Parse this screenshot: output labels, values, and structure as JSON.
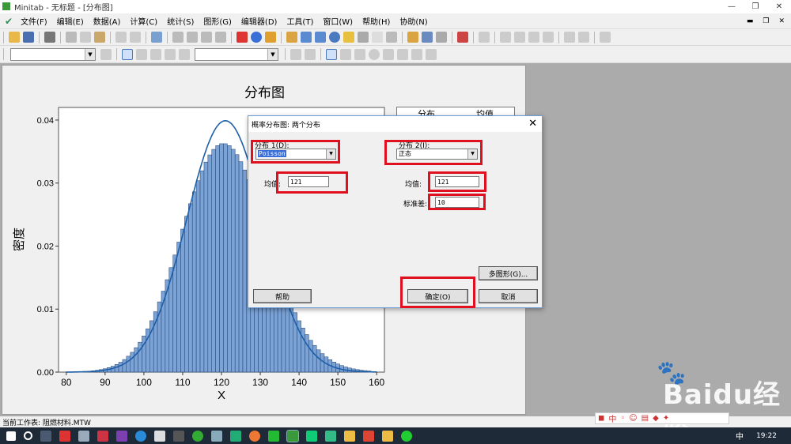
{
  "window": {
    "title": "Minitab - 无标题 - [分布图]"
  },
  "menubar": {
    "items": [
      "文件(F)",
      "编辑(E)",
      "数据(A)",
      "计算(C)",
      "统计(S)",
      "图形(G)",
      "编辑器(D)",
      "工具(T)",
      "窗口(W)",
      "帮助(H)",
      "协助(N)"
    ]
  },
  "graph": {
    "title": "分布图",
    "legend": [
      "分布",
      "均值"
    ]
  },
  "chart_data": {
    "type": "bar",
    "title": "分布图",
    "xlabel": "X",
    "ylabel": "密度",
    "xlim": [
      78,
      162
    ],
    "ylim": [
      0,
      0.042
    ],
    "xticks": [
      80,
      90,
      100,
      110,
      120,
      130,
      140,
      150,
      160
    ],
    "yticks": [
      "0.00",
      "0.01",
      "0.02",
      "0.03",
      "0.04"
    ],
    "grid": false,
    "series": [
      {
        "type": "bar",
        "distribution": "Poisson",
        "mean": 121
      },
      {
        "type": "line",
        "distribution": "正态",
        "mean": 121,
        "stdev": 10
      }
    ]
  },
  "dialog": {
    "title": "概率分布图: 两个分布",
    "dist1_label": "分布 1(D):",
    "dist1_value": "Poisson",
    "dist2_label": "分布 2(I):",
    "dist2_value": "正态",
    "mean1_label": "均值:",
    "mean1_value": "121",
    "mean2_label": "均值:",
    "mean2_value": "121",
    "std_label": "标准差:",
    "std_value": "10",
    "multi_btn": "多图形(G)...",
    "help_btn": "帮助",
    "ok_btn": "确定(O)",
    "cancel_btn": "取消"
  },
  "status": {
    "text": "当前工作表: 阻燃材料.MTW"
  },
  "taskbar": {
    "time": "19:22",
    "ime": "中"
  },
  "watermark": {
    "text": "Baidu经验"
  },
  "colors": {
    "bar_fill": "#7ba3d6",
    "bar_edge": "#1f3f6e",
    "curve": "#1f5fa8",
    "highlight": "#e01020"
  }
}
